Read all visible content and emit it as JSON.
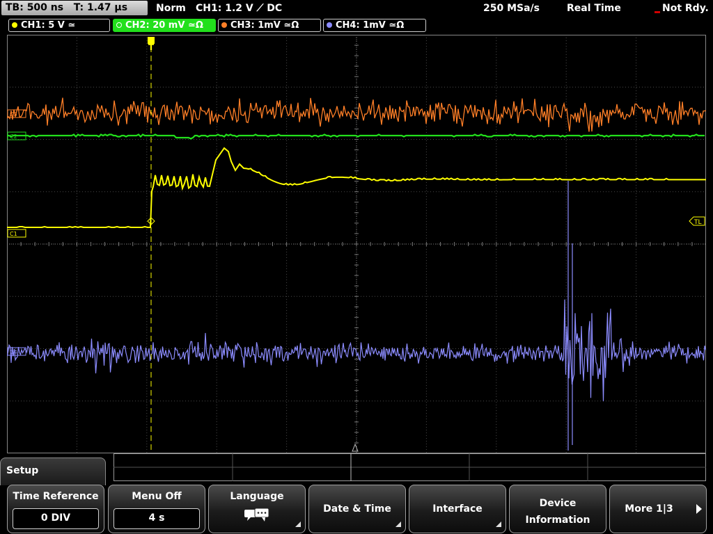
{
  "topbar": {
    "timebase": "TB: 500 ns",
    "trigger_time": "T: 1.47 µs",
    "trigger_mode": "Norm",
    "trigger_setting": "CH1: 1.2 V ⟋ DC",
    "sample_rate": "250 MSa/s",
    "acq_mode": "Real Time",
    "status": "Not Rdy."
  },
  "channels": [
    {
      "id": "ch1",
      "label": "CH1: 5 V",
      "suffix": " ≃",
      "color": "#ffff00",
      "active": false
    },
    {
      "id": "ch2",
      "label": "CH2: 20 mV",
      "suffix": " ≃Ω",
      "color": "#22e01c",
      "active": true
    },
    {
      "id": "ch3",
      "label": "CH3: 1mV",
      "suffix": " ≃Ω",
      "color": "#ff7f27",
      "active": false
    },
    {
      "id": "ch4",
      "label": "CH4: 1mV",
      "suffix": " ≃Ω",
      "color": "#8c8cff",
      "active": false
    }
  ],
  "markers": {
    "ch1_marker": "C1",
    "ch2_marker": "C2",
    "ch3_marker": "C3",
    "ch4_marker": "C4",
    "trigger_level": "TL",
    "trigger_flag": "T"
  },
  "menu": {
    "title": "Setup",
    "softkeys": [
      {
        "id": "time-reference",
        "label": "Time Reference",
        "value": "0 DIV"
      },
      {
        "id": "menu-off",
        "label": "Menu Off",
        "value": "4 s"
      },
      {
        "id": "language",
        "label": "Language",
        "icon": "speech-bubbles-icon"
      },
      {
        "id": "date-time",
        "label": "Date & Time"
      },
      {
        "id": "interface",
        "label": "Interface"
      },
      {
        "id": "device-information",
        "label": "Device Information"
      },
      {
        "id": "more",
        "label": "More 1|3"
      }
    ]
  },
  "colors": {
    "ch1": "#ffff00",
    "ch2": "#22e01c",
    "ch3": "#ff7f27",
    "ch4": "#8c8cff",
    "grid": "#6a6a6a",
    "status_red": "#d00000"
  }
}
